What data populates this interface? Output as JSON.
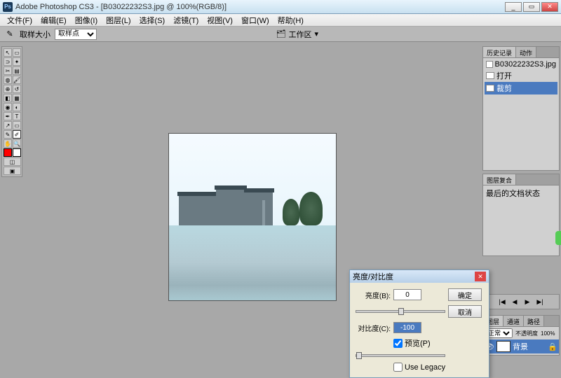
{
  "title": "Adobe Photoshop CS3 - [B03022232S3.jpg @ 100%(RGB/8)]",
  "menu": {
    "file": "文件(F)",
    "edit": "编辑(E)",
    "image": "图像(I)",
    "layer": "图层(L)",
    "select": "选择(S)",
    "filter": "滤镜(T)",
    "view": "视图(V)",
    "window": "窗口(W)",
    "help": "帮助(H)"
  },
  "optbar": {
    "sample_label": "取样大小",
    "sample_value": "取样点",
    "workspace_label": "工作区"
  },
  "history": {
    "tab": "历史记录",
    "tab2": "动作",
    "doc_name": "B03022232S3.jpg",
    "step1": "打开",
    "step2": "裁剪"
  },
  "clone_panel": {
    "tab": "图层复合",
    "note": "最后的文档状态"
  },
  "dialog": {
    "title": "亮度/对比度",
    "brightness_label": "亮度(B):",
    "brightness_value": "0",
    "contrast_label": "对比度(C):",
    "contrast_value": "-100",
    "ok": "确定",
    "cancel": "取消",
    "preview": "预览(P)",
    "legacy": "Use Legacy"
  },
  "layers": {
    "tab1": "图层",
    "tab2": "通道",
    "tab3": "路径",
    "mode": "正常",
    "opacity_label": "不透明度",
    "opacity": "100%",
    "layer_name": "背景"
  },
  "icons": {
    "ps": "Ps"
  }
}
